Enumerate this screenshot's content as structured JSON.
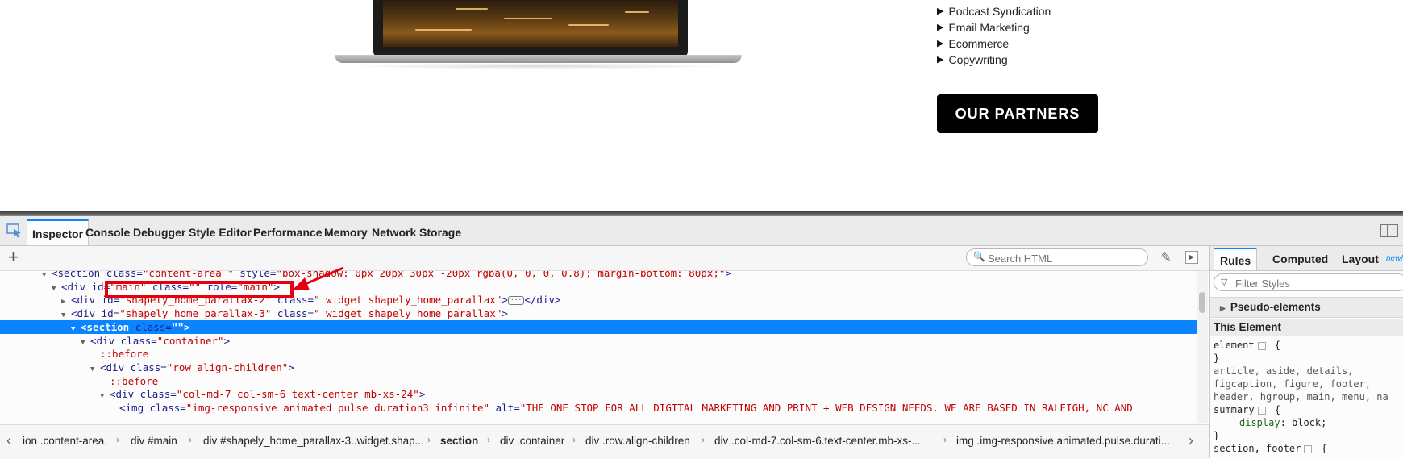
{
  "page": {
    "services": [
      "Podcast Syndication",
      "Email Marketing",
      "Ecommerce",
      "Copywriting"
    ],
    "partners_button": "OUR PARTNERS"
  },
  "devtools": {
    "tabs": [
      "Inspector",
      "Console",
      "Debugger",
      "Style Editor",
      "Performance",
      "Memory",
      "Network",
      "Storage"
    ],
    "search_placeholder": "Search HTML",
    "markup": [
      {
        "tw": "▼",
        "pre": "<section ",
        "a1": "class=",
        "v1": "\"content-area \"",
        "a2": " style=",
        "v2": "\"box-shadow: 0px 20px 30px -20px rgba(0, 0, 0, 0.8); margin-bottom: 80px;\"",
        "post": ">"
      },
      {
        "tw": "▼",
        "pre": "<div ",
        "a1": "id=",
        "v1": "\"main\"",
        "a2": " class=",
        "v2": "\"\"",
        "a3": " role=",
        "v3": "\"main\"",
        "post": ">"
      },
      {
        "tw": "▶",
        "pre": "<div ",
        "a1": "id=",
        "v1": "\"shapely_home_parallax-2\"",
        "a2": " class=",
        "v2": "\" widget shapely_home_parallax\"",
        "post": ">",
        "ellipsis": "···",
        "close": "</div>"
      },
      {
        "tw": "▼",
        "pre": "<div ",
        "a1": "id=",
        "v1": "\"shapely_home_parallax-3\"",
        "a2": " class=",
        "v2": "\" widget shapely_home_parallax\"",
        "post": ">"
      },
      {
        "tw": "▼",
        "pre": "<section ",
        "a1": "class=",
        "v1": "\"\"",
        "post": ">"
      },
      {
        "tw": "▼",
        "pre": "<div ",
        "a1": "class=",
        "v1": "\"container\"",
        "post": ">"
      },
      {
        "tw": "",
        "pseudo": "::before"
      },
      {
        "tw": "▼",
        "pre": "<div ",
        "a1": "class=",
        "v1": "\"row align-children\"",
        "post": ">"
      },
      {
        "tw": "",
        "pseudo": "::before"
      },
      {
        "tw": "▼",
        "pre": "<div ",
        "a1": "class=",
        "v1": "\"col-md-7 col-sm-6 text-center mb-xs-24\"",
        "post": ">"
      },
      {
        "tw": "",
        "pre": "<img ",
        "a1": "class=",
        "v1": "\"img-responsive animated pulse duration3 infinite\"",
        "a2": " alt=",
        "v2": "\"THE ONE STOP FOR ALL DIGITAL MARKETING AND PRINT + WEB DESIGN NEEDS. WE ARE BASED IN RALEIGH, NC AND",
        "post": ""
      }
    ],
    "breadcrumbs": [
      "ion .content-area.",
      "div #main",
      "div #shapely_home_parallax-3..widget.shap...",
      "section",
      "div .container",
      "div .row.align-children",
      "div .col-md-7.col-sm-6.text-center.mb-xs-...",
      "img .img-responsive.animated.pulse.durati..."
    ],
    "side_tabs": [
      "Rules",
      "Computed",
      "Layout"
    ],
    "new_badge": "new!",
    "filter_placeholder": "Filter Styles",
    "pseudo_elements": "Pseudo-elements",
    "this_element": "This Element",
    "rules": [
      {
        "sel": "element",
        "gear": true,
        "open": " {"
      },
      {
        "sel": "}"
      },
      {
        "sel": "article, aside, details,"
      },
      {
        "sel": "figcaption, figure, footer,"
      },
      {
        "sel": "header, hgroup, main, menu, na"
      },
      {
        "sel": "summary",
        "gear": true,
        "open": " {"
      },
      {
        "prop": "display",
        "value": "block;"
      },
      {
        "sel": "}"
      },
      {
        "sel": "section, footer",
        "gear": true,
        "open": " {"
      }
    ]
  },
  "colors": {
    "selection": "#0a84ff",
    "highlight": "#e6000f",
    "attr_value": "#c40000",
    "tag": "#1d1d8b"
  }
}
